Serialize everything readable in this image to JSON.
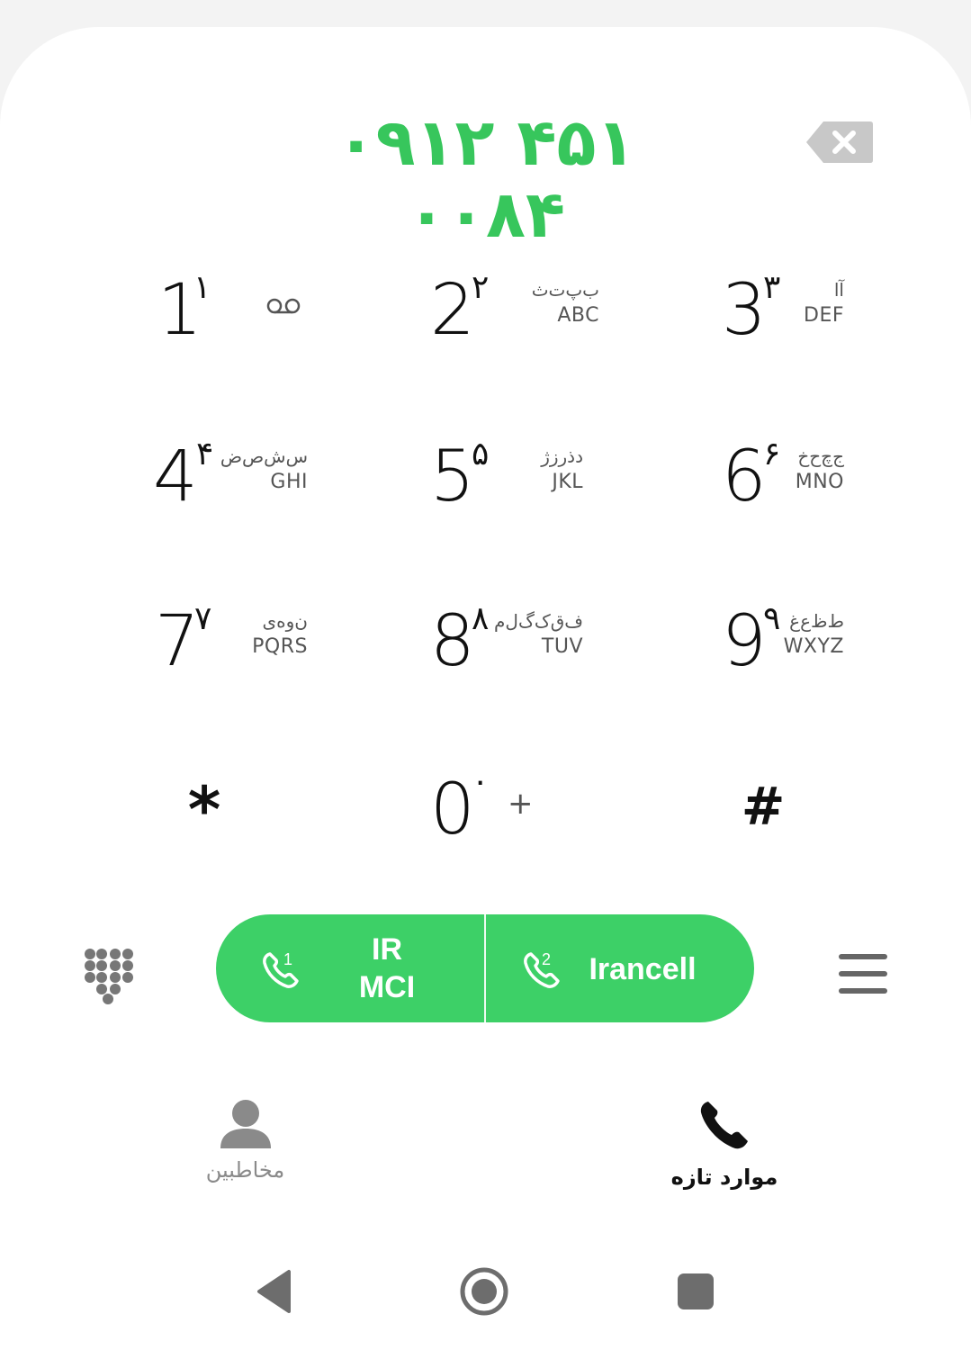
{
  "dialer": {
    "number": "۰۹۱۲ ۴۵۱ ۰۰۸۴"
  },
  "keypad": [
    {
      "digit": "1",
      "persian": "۱",
      "fa": "",
      "en": "",
      "extra": "voicemail-icon"
    },
    {
      "digit": "2",
      "persian": "۲",
      "fa": "ب‌پ‌ت‌ث",
      "en": "ABC"
    },
    {
      "digit": "3",
      "persian": "۳",
      "fa": "آا",
      "en": "DEF"
    },
    {
      "digit": "4",
      "persian": "۴",
      "fa": "س‌ش‌ص‌ض",
      "en": "GHI"
    },
    {
      "digit": "5",
      "persian": "۵",
      "fa": "د‌ذ‌ر‌ز‌ژ",
      "en": "JKL"
    },
    {
      "digit": "6",
      "persian": "۶",
      "fa": "ج‌چ‌ح‌خ",
      "en": "MNO"
    },
    {
      "digit": "7",
      "persian": "۷",
      "fa": "ن‌و‌ه‌ی",
      "en": "PQRS"
    },
    {
      "digit": "8",
      "persian": "۸",
      "fa": "ف‌ق‌ک‌گ‌ل‌م",
      "en": "TUV"
    },
    {
      "digit": "9",
      "persian": "۹",
      "fa": "ط‌ظ‌ع‌غ",
      "en": "WXYZ"
    }
  ],
  "bottom_row": {
    "star": "*",
    "zero": "0",
    "zero_persian": "۰",
    "zero_plus": "+",
    "hash": "#"
  },
  "call": {
    "sim1_line1": "IR",
    "sim1_line2": "MCI",
    "sim1_index": "1",
    "sim2_label": "Irancell",
    "sim2_index": "2",
    "color": "#3dd067"
  },
  "tabs": {
    "contacts": "مخاطبین",
    "recents": "موارد تازه"
  },
  "colors": {
    "accent": "#37c65c",
    "text": "#111111",
    "muted": "#888888"
  }
}
